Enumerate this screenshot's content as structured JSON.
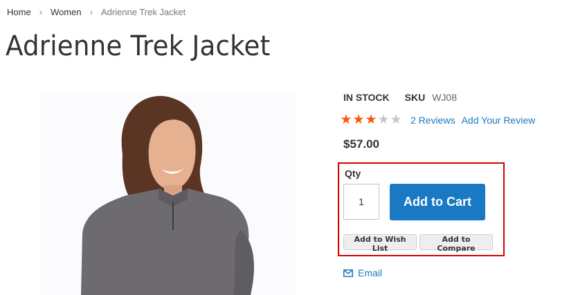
{
  "breadcrumb": {
    "home": "Home",
    "category": "Women",
    "current": "Adrienne Trek Jacket"
  },
  "product": {
    "title": "Adrienne Trek Jacket",
    "stock": "In stock",
    "sku_label": "SKU",
    "sku_value": "WJ08",
    "rating": {
      "stars_filled": 3,
      "stars_total": 5,
      "reviews_label": "2 Reviews",
      "add_review_label": "Add Your Review"
    },
    "price": "$57.00"
  },
  "cart": {
    "qty_label": "Qty",
    "qty_value": "1",
    "add_to_cart_label": "Add to Cart",
    "wishlist_label": "Add to Wish List",
    "compare_label": "Add to Compare"
  },
  "email_label": "Email",
  "colors": {
    "link": "#1979c3",
    "primary_button": "#1979c3",
    "star": "#ff5501",
    "highlight_border": "#d40000"
  }
}
